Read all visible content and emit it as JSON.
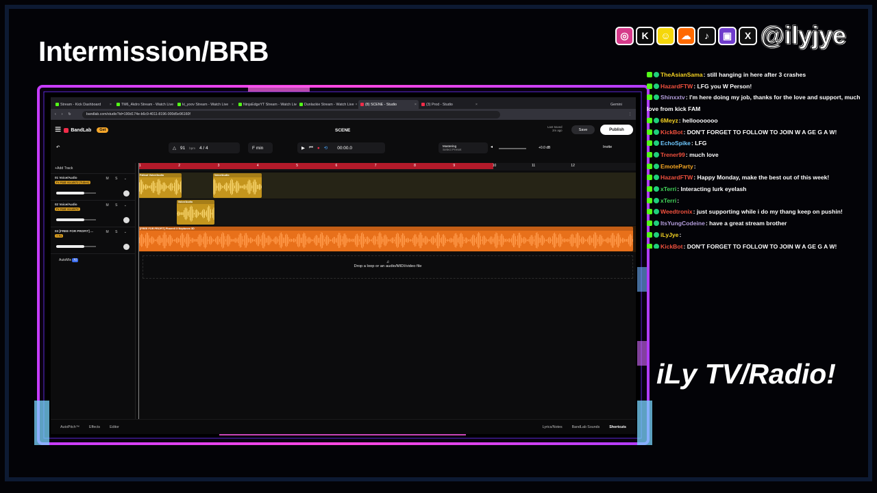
{
  "overlay": {
    "title": "Intermission/BRB",
    "handle": "@ilyjye",
    "radio_label": "iLy TV/Radio!",
    "accent_pink": "#ff3fd5",
    "accent_blue": "#3a7bff",
    "socials": [
      {
        "icon": "instagram-icon",
        "color": "#d63a8a",
        "glyph": "◎"
      },
      {
        "icon": "kick-icon",
        "color": "#0b0b0b",
        "glyph": "K"
      },
      {
        "icon": "snapchat-icon",
        "color": "#f5d70a",
        "glyph": "☺"
      },
      {
        "icon": "soundcloud-icon",
        "color": "#ff6a00",
        "glyph": "☁"
      },
      {
        "icon": "tiktok-icon",
        "color": "#111111",
        "glyph": "♪"
      },
      {
        "icon": "twitch-icon",
        "color": "#6f3ccc",
        "glyph": "▣"
      },
      {
        "icon": "x-icon",
        "color": "#111111",
        "glyph": "X"
      }
    ]
  },
  "chat": [
    {
      "user": "TheAsianSama",
      "color": "#f5d323",
      "text": ": still hanging in here after 3 crashes"
    },
    {
      "user": "HazardFTW",
      "color": "#f2513e",
      "text": ": LFG you W Person!"
    },
    {
      "user": "Shinxxtv",
      "color": "#b39ddb",
      "text": ": I'm here doing my job, thanks for the love and support, much love from kick FAM"
    },
    {
      "user": "6Meyz",
      "color": "#f5d323",
      "text": ": hellooooooo"
    },
    {
      "user": "KickBot",
      "color": "#f2513e",
      "text": ": DON'T FORGET TO FOLLOW TO JOIN W A GE G A W!"
    },
    {
      "user": "EchoSpike",
      "color": "#6ec8ff",
      "text": ": LFG"
    },
    {
      "user": "Trener99",
      "color": "#f2513e",
      "text": ": much love"
    },
    {
      "user": "EmoteParty",
      "color": "#f5a623",
      "text": ":"
    },
    {
      "user": "HazardFTW",
      "color": "#f2513e",
      "text": ": Happy Monday, make the best out of this week!"
    },
    {
      "user": "xTerri",
      "color": "#43d65a",
      "text": ": Interacting lurk eyelash"
    },
    {
      "user": "xTerri",
      "color": "#43d65a",
      "text": ":"
    },
    {
      "user": "Weedtronix",
      "color": "#f2513e",
      "text": ": just supporting while i do my thang keep on pushin!"
    },
    {
      "user": "ItsYungCodeine",
      "color": "#b39ddb",
      "text": ": have a great stream brother"
    },
    {
      "user": "iLyJye",
      "color": "#f5d323",
      "text": ":"
    },
    {
      "user": "KickBot",
      "color": "#f2513e",
      "text": ": DON'T FORGET TO FOLLOW TO JOIN W A GE G A W!"
    }
  ],
  "browser": {
    "tabs": [
      {
        "label": "Stream - Kick Dashboard",
        "color": "#53fc18"
      },
      {
        "label": "TM6_4kdro Stream - Watch Live",
        "color": "#53fc18"
      },
      {
        "label": "ki_yoov Stream - Watch Live",
        "color": "#53fc18"
      },
      {
        "label": "NinjaEdgeYT Stream - Watch Live",
        "color": "#53fc18"
      },
      {
        "label": "Dunlackie Stream - Watch Live",
        "color": "#53fc18"
      },
      {
        "label": "(8) SCENE - Studio",
        "color": "#f02c49",
        "active": true
      },
      {
        "label": "(3) Prod - Studio",
        "color": "#f02c49"
      }
    ],
    "gemini": "Gemini",
    "url": "bandlab.com/studio?id=190d174e-b6c9-4011-8196-000d5e96160f"
  },
  "daw": {
    "brand": "BandLab",
    "get_label": "Get",
    "project": "SCENE",
    "last_saved": "Last Saved",
    "last_saved_time": "2m ago",
    "save_label": "Save",
    "publish_label": "Publish",
    "invite_label": "Invite",
    "bpm": "91",
    "bpm_unit": "bpm",
    "time_sig": "4 / 4",
    "key": "F min",
    "time": "00:00.0",
    "mastering": "Mastering",
    "mastering_sub": "Select Preset",
    "volume_db": "+0.0 dB",
    "add_track": "Add Track",
    "automix": "AutoMix",
    "ai_badge": "AI",
    "drop_text": "Drop a loop or an audio/MIDI/video file",
    "ruler": [
      "1",
      "2",
      "3",
      "4",
      "5",
      "6",
      "7",
      "8",
      "9",
      "10",
      "11",
      "12"
    ],
    "tracks": [
      {
        "name": "01  Voice/Audio",
        "fx": "Fx R&B Vocals72 (Tubes)",
        "clips": [
          {
            "label": "Fallout  Voice/Audio",
            "start": 0,
            "len": 1.1,
            "color": "y"
          },
          {
            "label": "Voice/Audio",
            "start": 1.9,
            "len": 1.25,
            "color": "y"
          }
        ]
      },
      {
        "name": "02  Voice/Audio",
        "fx": "Fx R&B Vocals72",
        "clips": [
          {
            "label": "Voice/Audio",
            "start": 0.97,
            "len": 0.97,
            "color": "y"
          }
        ]
      },
      {
        "name": "03  [FREE FOR PROFIT] ...",
        "fx": "+ Fx",
        "clips": [
          {
            "label": "[FREE FOR PROFIT] Pharrell X Neptunes 3D",
            "start": 0,
            "len": 12.6,
            "color": "o"
          }
        ]
      }
    ],
    "bottom": {
      "autopitch": "AutoPitch™",
      "effects": "Effects",
      "editor": "Editor",
      "lyrics": "Lyrics/Notes",
      "sounds": "BandLab Sounds",
      "shortcuts": "Shortcuts"
    }
  }
}
